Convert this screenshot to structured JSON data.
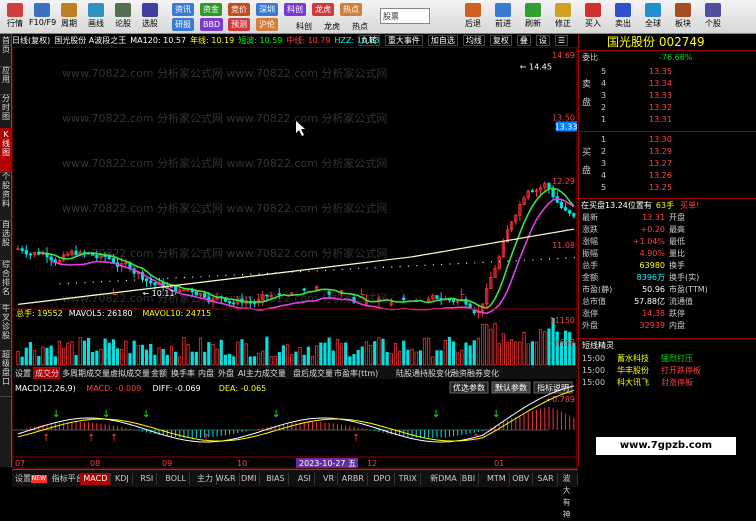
{
  "toolbar": {
    "buttons": [
      {
        "label": "行情",
        "name": "quote"
      },
      {
        "label": "F10/F9",
        "name": "f10"
      },
      {
        "label": "周期",
        "name": "period"
      },
      {
        "label": "画线",
        "name": "draw"
      },
      {
        "label": "论股",
        "name": "discuss"
      },
      {
        "label": "选股",
        "name": "select-stock"
      }
    ],
    "group2_top": [
      "资讯",
      "资金",
      "竞价",
      "深圳",
      "科创",
      "龙虎",
      "热点"
    ],
    "group2_bottom": [
      "研报",
      "BBD",
      "预测",
      "沪伦",
      "",
      "",
      ""
    ],
    "right_buttons": [
      {
        "label": "后退",
        "name": "back"
      },
      {
        "label": "前进",
        "name": "forward"
      },
      {
        "label": "刷新",
        "name": "refresh"
      },
      {
        "label": "修正",
        "name": "correct"
      },
      {
        "label": "买入",
        "name": "buy"
      },
      {
        "label": "卖出",
        "name": "sell"
      },
      {
        "label": "全球",
        "name": "global"
      },
      {
        "label": "板块",
        "name": "sector"
      },
      {
        "label": "个股",
        "name": "stock"
      }
    ],
    "bottom_labels": [
      "科创",
      "龙虎",
      "热点"
    ],
    "search_label": "股票"
  },
  "left_tabs": [
    "首页",
    "应用",
    "分时图",
    "K线图",
    "个股资料",
    "自选股",
    "综合排名",
    "牛叉诊股",
    "超级盘口"
  ],
  "infobar": {
    "items": [
      {
        "text": "日线(复权)",
        "color": "#ffffff"
      },
      {
        "text": "国光股份 A波段之王",
        "color": "#ffffff"
      },
      {
        "text": "MA120: 10.57",
        "color": "#ffffff"
      },
      {
        "text": "年线: 10.19",
        "color": "#ffff00"
      },
      {
        "text": "短波: 10.59",
        "color": "#00ff00"
      },
      {
        "text": "中线: 10.79",
        "color": "#ff4040"
      },
      {
        "text": "HZZ: 10.63",
        "color": "#00ffff"
      }
    ],
    "tools": [
      "九转",
      "重大事件",
      "加自选",
      "均线",
      "复权",
      "叠",
      "设",
      "☰"
    ]
  },
  "chart_labels": {
    "price_ticks": [
      "14.69",
      "13.50",
      "12.29",
      "11.08"
    ],
    "high_label": "14.45",
    "low_label": "10.11",
    "vol_ticks": [
      "11150",
      "5658"
    ],
    "volume_info": [
      {
        "text": "总手: 19552",
        "color": "#ffff00"
      },
      {
        "text": "MAVOL5: 26180",
        "color": "#ffffff"
      },
      {
        "text": "MAVOL10: 24715",
        "color": "#ffff00"
      }
    ],
    "macd_info": [
      {
        "text": "MACD(12,26,9)",
        "color": "#ffffff"
      },
      {
        "text": "MACD: -0.009",
        "color": "#ff4040"
      },
      {
        "text": "DIFF: -0.069",
        "color": "#ffffff"
      },
      {
        "text": "DEA: -0.065",
        "color": "#ffff00"
      }
    ],
    "macd_tick": "+0.789",
    "x_axis": [
      "07",
      "08",
      "09",
      "10",
      "11",
      "12",
      "01"
    ],
    "date_badge": "2023-10-27 五",
    "current_price_tag": "13.33",
    "watermark_text": "www.70822.com 分析家公式网",
    "L_markers": [
      "L",
      "L",
      "L"
    ]
  },
  "mid_tabs": [
    "设置",
    "成交分",
    "多周期成交量",
    "虚拟成交量",
    "金额",
    "换手率",
    "内盘",
    "外盘",
    "AI主力成交量",
    "盘后成交量",
    "市盈率(ttm)",
    "陆股通持股变化",
    "融资融券变化"
  ],
  "mid_buttons": [
    "优选参数",
    "默认参数",
    "指标说明"
  ],
  "bottom_tabs": [
    "设置",
    "指标平台",
    "MACD",
    "KDJ",
    "RSI",
    "BOLL",
    "主力",
    "W&R",
    "DMI",
    "BIAS",
    "ASI",
    "VR",
    "ARBR",
    "DPO",
    "TRIX",
    "新DMA",
    "BBI",
    "MTM",
    "OBV",
    "SAR",
    "波大有神"
  ],
  "bottom_new_badge": "NEW",
  "right_panel": {
    "title": "国光股份",
    "code": "002749",
    "wei_bi": {
      "label": "委比",
      "value": "-76.66%"
    },
    "sell_label": [
      "卖",
      "盘"
    ],
    "buy_label": [
      "买",
      "盘"
    ],
    "sell": [
      {
        "n": "5",
        "p": "13.35",
        "v": ""
      },
      {
        "n": "4",
        "p": "13.34",
        "v": ""
      },
      {
        "n": "3",
        "p": "13.33",
        "v": ""
      },
      {
        "n": "2",
        "p": "13.32",
        "v": ""
      },
      {
        "n": "1",
        "p": "13.31",
        "v": ""
      }
    ],
    "buy": [
      {
        "n": "1",
        "p": "13.30",
        "v": ""
      },
      {
        "n": "2",
        "p": "13.29",
        "v": ""
      },
      {
        "n": "3",
        "p": "13.27",
        "v": ""
      },
      {
        "n": "4",
        "p": "13.26",
        "v": ""
      },
      {
        "n": "5",
        "p": "13.25",
        "v": ""
      }
    ],
    "inbuy": {
      "label": "在买盘13.24位置有",
      "vol": "63手",
      "action": "买单!"
    },
    "stats": [
      {
        "l1": "最新",
        "v1": "13.31",
        "c1": "red",
        "l2": "开盘",
        "v2": ""
      },
      {
        "l1": "涨跌",
        "v1": "+0.20",
        "c1": "red",
        "l2": "最高",
        "v2": ""
      },
      {
        "l1": "涨幅",
        "v1": "+1.04%",
        "c1": "red",
        "l2": "最低",
        "v2": ""
      },
      {
        "l1": "振幅",
        "v1": "4.90%",
        "c1": "red",
        "l2": "量比",
        "v2": ""
      },
      {
        "l1": "总手",
        "v1": "63980",
        "c1": "yellow",
        "l2": "换手",
        "v2": ""
      },
      {
        "l1": "金额",
        "v1": "8396万",
        "c1": "cyan",
        "l2": "换手(实)",
        "v2": ""
      },
      {
        "l1": "市盈(静)",
        "v1": "50.96",
        "c1": "white",
        "l2": "市盈(TTM)",
        "v2": ""
      },
      {
        "l1": "总市值",
        "v1": "57.88亿",
        "c1": "white",
        "l2": "流通值",
        "v2": ""
      },
      {
        "l1": "涨停",
        "v1": "14.38",
        "c1": "red",
        "l2": "跌停",
        "v2": ""
      },
      {
        "l1": "外盘",
        "v1": "32939",
        "c1": "red",
        "l2": "内盘",
        "v2": ""
      }
    ],
    "elf_title": "短线精灵",
    "elf": [
      {
        "time": "15:00",
        "name": "蓄水科技",
        "event": "猛烈打压"
      },
      {
        "time": "15:00",
        "name": "华丰股份",
        "event": "打开跌停板"
      },
      {
        "time": "15:00",
        "name": "科大讯飞",
        "event": "封涨停板"
      }
    ]
  },
  "footer_watermark": "www.7gpzb.com",
  "colors": {
    "red": "#ff3030",
    "green": "#00e0e0",
    "yellow": "#ffff00",
    "magenta": "#e040e0",
    "ma_green": "#40e040"
  }
}
